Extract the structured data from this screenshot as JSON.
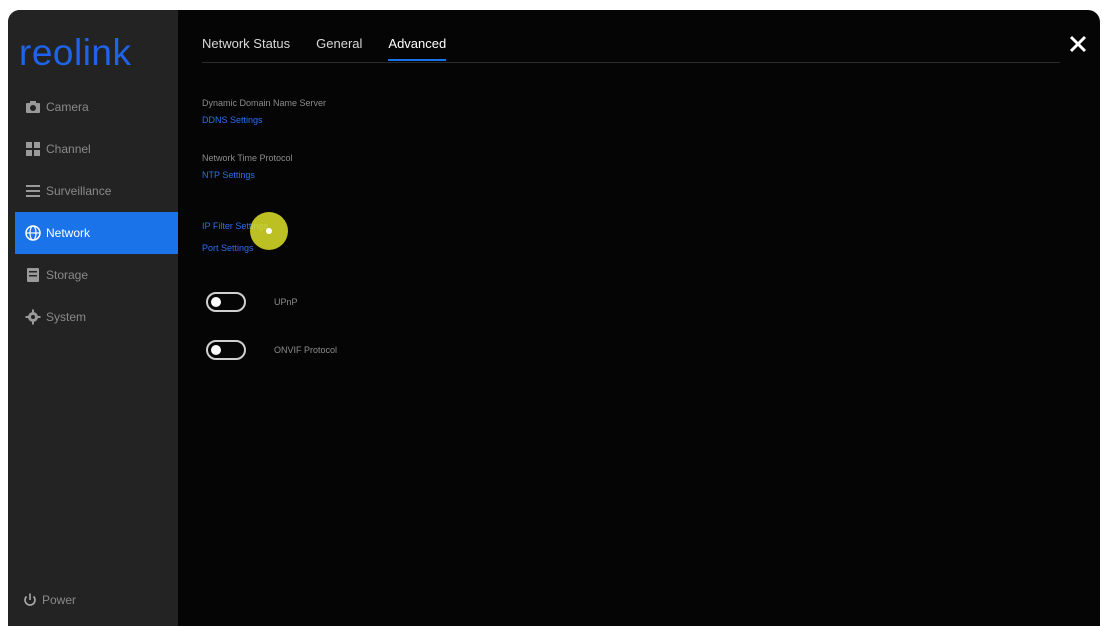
{
  "logo": "reolink",
  "sidebar": {
    "items": [
      {
        "label": "Camera",
        "icon": "camera-icon"
      },
      {
        "label": "Channel",
        "icon": "grid-icon"
      },
      {
        "label": "Surveillance",
        "icon": "list-icon"
      },
      {
        "label": "Network",
        "icon": "globe-icon",
        "active": true
      },
      {
        "label": "Storage",
        "icon": "storage-icon"
      },
      {
        "label": "System",
        "icon": "gear-icon"
      }
    ],
    "power_label": "Power"
  },
  "tabs": [
    {
      "label": "Network Status"
    },
    {
      "label": "General"
    },
    {
      "label": "Advanced",
      "active": true
    }
  ],
  "sections": [
    {
      "label": "Dynamic Domain Name Server",
      "link": "DDNS Settings"
    },
    {
      "label": "Network Time Protocol",
      "link": "NTP Settings"
    },
    {
      "label": "",
      "link": "IP Filter Settings"
    },
    {
      "label": "",
      "link": "Port Settings"
    }
  ],
  "toggles": [
    {
      "label": "UPnP",
      "on": false
    },
    {
      "label": "ONVIF Protocol",
      "on": false
    }
  ],
  "colors": {
    "accent": "#1a73e8",
    "link": "#2f6df0",
    "background": "#050505",
    "sidebar": "#232323",
    "cursor_highlight": "#dee228"
  }
}
